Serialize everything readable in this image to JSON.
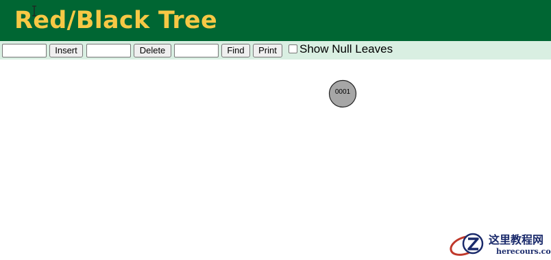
{
  "header": {
    "title": "Red/Black Tree"
  },
  "toolbar": {
    "insert_input_value": "",
    "insert_label": "Insert",
    "delete_input_value": "",
    "delete_label": "Delete",
    "find_input_value": "",
    "find_label": "Find",
    "print_label": "Print",
    "null_leaves_checked": false,
    "null_leaves_label": "Show Null Leaves"
  },
  "tree": {
    "nodes": [
      {
        "value": "0001",
        "color": "black"
      }
    ]
  },
  "watermark": {
    "text_cn": "这里教程网",
    "text_en": "herecours.com"
  },
  "colors": {
    "header_bg": "#006633",
    "title_color": "#f7c845",
    "toolbar_bg": "#d9efe2",
    "node_fill": "#a6a6a6",
    "node_stroke": "#222222"
  },
  "icons": {
    "cursor": "text-cursor-icon",
    "watermark_logo": "z-logo-icon"
  }
}
